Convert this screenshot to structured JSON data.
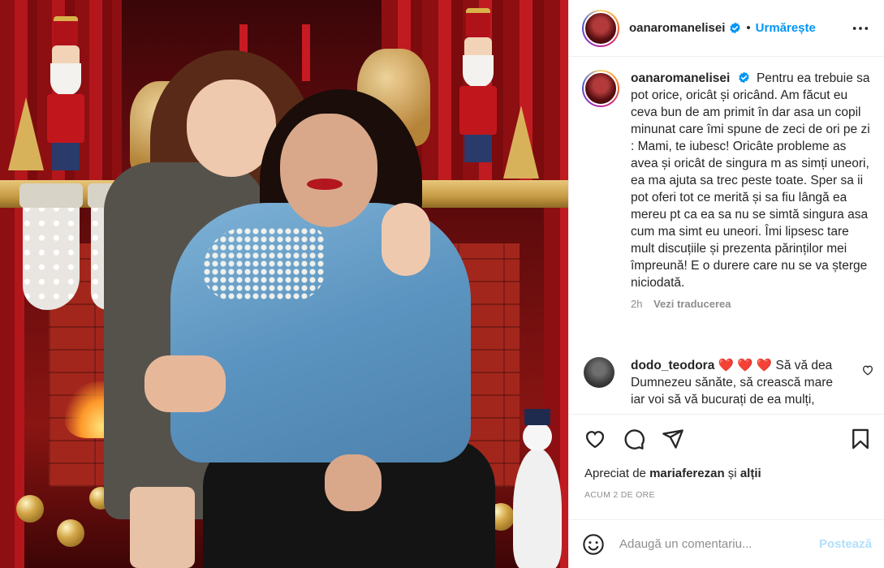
{
  "post": {
    "photo_alt": ""
  },
  "header": {
    "username": "oanaromanelisei",
    "separator": "•",
    "follow_label": "Urmărește"
  },
  "caption": {
    "username": "oanaromanelisei",
    "text": "Pentru ea trebuie sa pot orice, oricât și oricând. Am făcut eu ceva bun de am primit în dar asa un copil minunat care îmi spune de zeci de ori pe zi : Mami, te iubesc! Oricâte probleme as avea și oricât de singura m as simți uneori, ea ma ajuta sa trec peste toate. Sper sa ii pot oferi tot ce merită și sa fiu lângă ea mereu pt ca ea sa nu se simtă singura asa cum ma simt eu uneori. Îmi lipsesc tare mult discuțiile și prezenta părinților mei împreună! E o durere care nu se va șterge niciodată.",
    "age": "2h",
    "translate_label": "Vezi traducerea"
  },
  "comment": {
    "username": "dodo_teodora",
    "hearts": "❤️ ❤️ ❤️",
    "text": "Să vă dea Dumnezeu sănăte, să crească mare iar voi să vă bucurați de ea mulți,"
  },
  "likes": {
    "prefix": "Apreciat de",
    "user": "mariaferezan",
    "suffix": "și",
    "others": "alții"
  },
  "timestamp": "ACUM 2 DE ORE",
  "add_comment": {
    "placeholder": "Adaugă un comentariu...",
    "post_label": "Postează"
  },
  "colors": {
    "accent": "#0095f6",
    "post_disabled": "#b2dffc",
    "muted": "#8e8e8e",
    "text": "#262626"
  },
  "icons": [
    "verified-badge-icon",
    "more-options-icon",
    "heart-icon",
    "comment-icon",
    "share-icon",
    "bookmark-icon",
    "emoji-icon"
  ]
}
